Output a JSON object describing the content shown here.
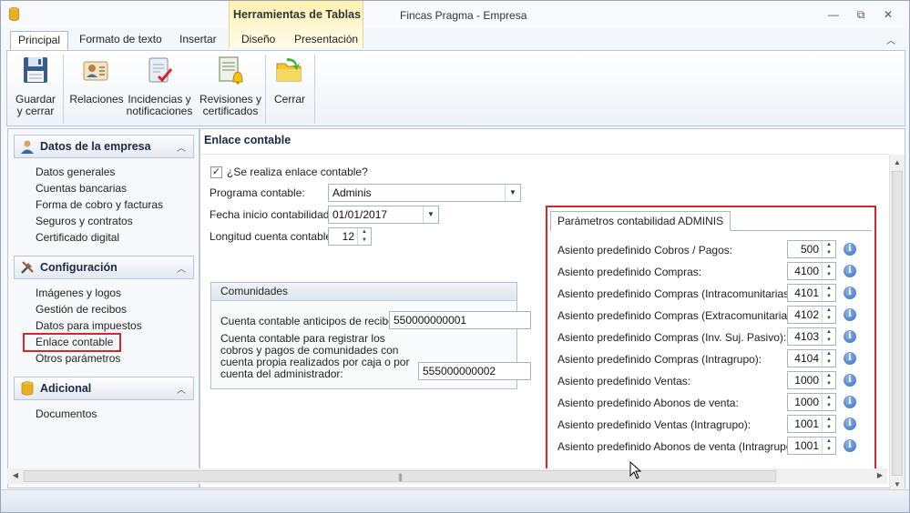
{
  "window": {
    "title": "Fincas Pragma - Empresa",
    "context_group": "Herramientas de Tablas",
    "controls": {
      "minimize": "—",
      "restore": "⧉",
      "close": "✕"
    }
  },
  "ribbon": {
    "tabs": [
      {
        "label": "Principal",
        "active": true
      },
      {
        "label": "Formato de texto"
      },
      {
        "label": "Insertar"
      },
      {
        "label": "Diseño"
      },
      {
        "label": "Presentación"
      }
    ],
    "buttons": [
      {
        "label": "Guardar\ny cerrar",
        "icon": "floppy-disk-icon"
      },
      {
        "label": "Relaciones",
        "icon": "contacts-card-icon"
      },
      {
        "label": "Incidencias y\nnotificaciones",
        "icon": "clipboard-check-icon"
      },
      {
        "label": "Revisiones y\ncertificados",
        "icon": "document-bell-icon"
      },
      {
        "label": "Cerrar",
        "icon": "folder-arrow-icon"
      }
    ]
  },
  "sidebar": {
    "sections": [
      {
        "title": "Datos de la empresa",
        "icon": "user-icon",
        "items": [
          "Datos generales",
          "Cuentas bancarias",
          "Forma de cobro y facturas",
          "Seguros y contratos",
          "Certificado digital"
        ]
      },
      {
        "title": "Configuración",
        "icon": "tools-icon",
        "items": [
          "Imágenes y logos",
          "Gestión de recibos",
          "Datos para impuestos",
          "Enlace contable",
          "Otros parámetros"
        ],
        "selected": "Enlace contable"
      },
      {
        "title": "Adicional",
        "icon": "database-icon",
        "items": [
          "Documentos"
        ]
      }
    ]
  },
  "content": {
    "title": "Enlace contable",
    "enlace_check_label": "¿Se realiza enlace contable?",
    "enlace_checked": true,
    "programa_label": "Programa contable:",
    "programa_value": "Adminis",
    "fecha_label": "Fecha inicio contabilidad:",
    "fecha_value": "01/01/2017",
    "longitud_label": "Longitud cuenta contable:",
    "longitud_value": "12",
    "comunidades": {
      "title": "Comunidades",
      "anticipos_label": "Cuenta contable anticipos de recibos:",
      "anticipos_value": "550000000001",
      "registrar_label": "Cuenta contable para registrar los cobros y pagos de comunidades con cuenta propia realizados por caja o por cuenta del administrador:",
      "registrar_value": "555000000002"
    },
    "parametros": {
      "tab_label": "Parámetros contabilidad ADMINIS",
      "rows": [
        {
          "label": "Asiento  predefinido Cobros / Pagos:",
          "value": "500"
        },
        {
          "label": "Asiento  predefinido Compras:",
          "value": "4100"
        },
        {
          "label": "Asiento  predefinido Compras (Intracomunitarias):",
          "value": "4101"
        },
        {
          "label": "Asiento  predefinido Compras (Extracomunitarias):",
          "value": "4102"
        },
        {
          "label": "Asiento  predefinido Compras (Inv. Suj. Pasivo):",
          "value": "4103"
        },
        {
          "label": "Asiento  predefinido Compras (Intragrupo):",
          "value": "4104"
        },
        {
          "label": "Asiento  predefinido Ventas:",
          "value": "1000"
        },
        {
          "label": "Asiento  predefinido Abonos de venta:",
          "value": "1000"
        },
        {
          "label": "Asiento  predefinido Ventas (Intragrupo):",
          "value": "1001"
        },
        {
          "label": "Asiento  predefinido Abonos de venta (Intragrupo):",
          "value": "1001"
        }
      ]
    }
  },
  "colors": {
    "highlight_red": "#d9262b",
    "context_yellow": "#fff3b0",
    "info_blue": "#3b6fc4"
  }
}
